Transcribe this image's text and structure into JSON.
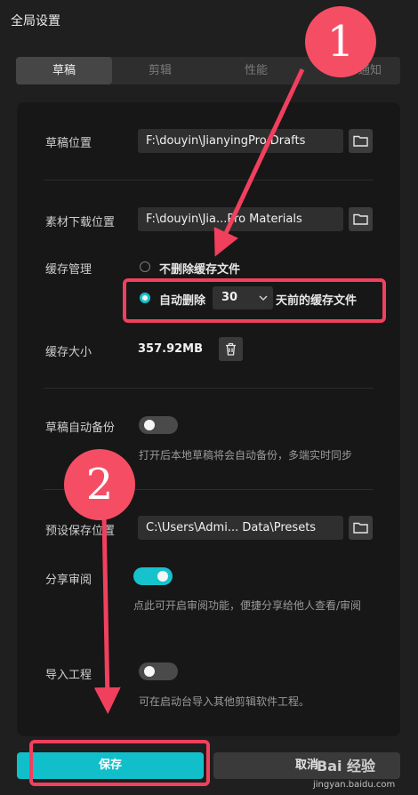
{
  "window": {
    "title": "全局设置"
  },
  "tabs": [
    {
      "label": "草稿",
      "active": true
    },
    {
      "label": "剪辑",
      "active": false
    },
    {
      "label": "性能",
      "active": false
    },
    {
      "label": "通知",
      "active": false
    }
  ],
  "draft": {
    "location_label": "草稿位置",
    "location_value": "F:\\douyin\\JianyingPro Drafts",
    "material_label": "素材下载位置",
    "material_value": "F:\\douyin\\Jia...Pro Materials",
    "cache_label": "缓存管理",
    "cache_option_keep": "不删除缓存文件",
    "cache_option_auto_prefix": "自动删除",
    "cache_days": "30",
    "cache_option_auto_suffix": "天前的缓存文件",
    "cache_size_label": "缓存大小",
    "cache_size_value": "357.92MB",
    "backup_label": "草稿自动备份",
    "backup_enabled": false,
    "backup_hint": "打开后本地草稿将会自动备份，多端实时同步",
    "preset_label": "预设保存位置",
    "preset_value": "C:\\Users\\Admi... Data\\Presets",
    "review_label": "分享审阅",
    "review_enabled": true,
    "review_hint": "点此可开启审阅功能，便捷分享给他人查看/审阅",
    "import_label": "导入工程",
    "import_enabled": false,
    "import_hint": "可在启动台导入其他剪辑软件工程。"
  },
  "footer": {
    "save_label": "保存",
    "cancel_label": "取消"
  },
  "annotations": {
    "step1": "1",
    "step2": "2"
  },
  "watermark": {
    "brand": "Bai 经验",
    "url": "jingyan.baidu.com"
  },
  "colors": {
    "accent": "#16c2cc",
    "annotation": "#f0405e"
  },
  "icons": [
    "folder-icon",
    "trash-icon",
    "chevron-down-icon"
  ]
}
